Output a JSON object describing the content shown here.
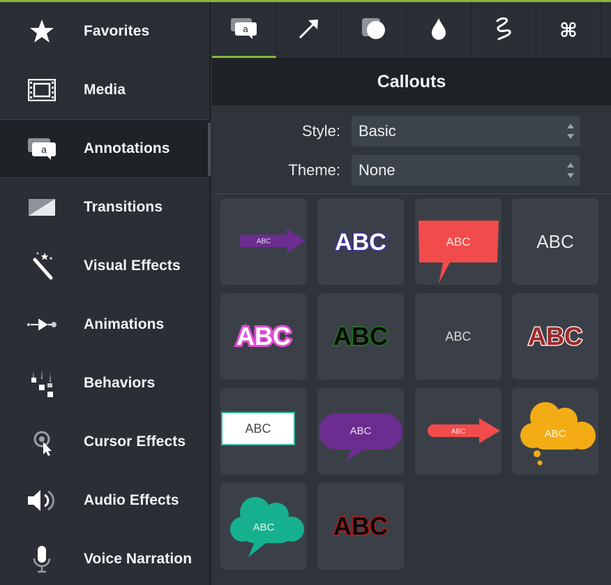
{
  "sidebar": {
    "items": [
      {
        "label": "Favorites",
        "icon": "star-icon"
      },
      {
        "label": "Media",
        "icon": "film-icon"
      },
      {
        "label": "Annotations",
        "icon": "annotation-icon",
        "active": true
      },
      {
        "label": "Transitions",
        "icon": "transition-icon"
      },
      {
        "label": "Visual Effects",
        "icon": "magic-wand-icon"
      },
      {
        "label": "Animations",
        "icon": "animation-icon"
      },
      {
        "label": "Behaviors",
        "icon": "behaviors-icon"
      },
      {
        "label": "Cursor Effects",
        "icon": "cursor-icon"
      },
      {
        "label": "Audio Effects",
        "icon": "speaker-icon"
      },
      {
        "label": "Voice Narration",
        "icon": "microphone-icon"
      }
    ]
  },
  "toolbar": {
    "tabs": [
      {
        "icon": "callout-icon",
        "active": true
      },
      {
        "icon": "arrow-icon"
      },
      {
        "icon": "shape-icon"
      },
      {
        "icon": "blur-drop-icon"
      },
      {
        "icon": "sketch-motion-icon"
      },
      {
        "icon": "keystroke-icon",
        "glyph": "⌘"
      }
    ]
  },
  "panel": {
    "title": "Callouts",
    "style_label": "Style:",
    "style_value": "Basic",
    "theme_label": "Theme:",
    "theme_value": "None"
  },
  "callouts": [
    {
      "kind": "arrow",
      "text": "ABC",
      "color": "#6b2d8f"
    },
    {
      "kind": "outline-text",
      "text": "ABC",
      "color": "#3e2f9e"
    },
    {
      "kind": "speech-box",
      "text": "ABC",
      "color": "#f24b4b"
    },
    {
      "kind": "plain-text",
      "text": "ABC",
      "color": "#e8e8e8"
    },
    {
      "kind": "outline-text",
      "text": "ABC",
      "color": "#e24bd6"
    },
    {
      "kind": "outline-text",
      "text": "ABC",
      "color": "#1f7a1a"
    },
    {
      "kind": "plain-text",
      "text": "ABC",
      "color": "#d8d8d8"
    },
    {
      "kind": "outline-text",
      "text": "ABC",
      "color": "#9e2a2a"
    },
    {
      "kind": "text-box",
      "text": "ABC",
      "color": "#ffffff"
    },
    {
      "kind": "speech-bubble",
      "text": "ABC",
      "color": "#6b2d8f"
    },
    {
      "kind": "arrow",
      "text": "ABC",
      "color": "#f24b4b"
    },
    {
      "kind": "thought-cloud",
      "text": "ABC",
      "color": "#f4ac14"
    },
    {
      "kind": "speech-cloud",
      "text": "ABC",
      "color": "#17b08e"
    },
    {
      "kind": "outline-text",
      "text": "ABC",
      "color": "#b91c1c"
    }
  ]
}
